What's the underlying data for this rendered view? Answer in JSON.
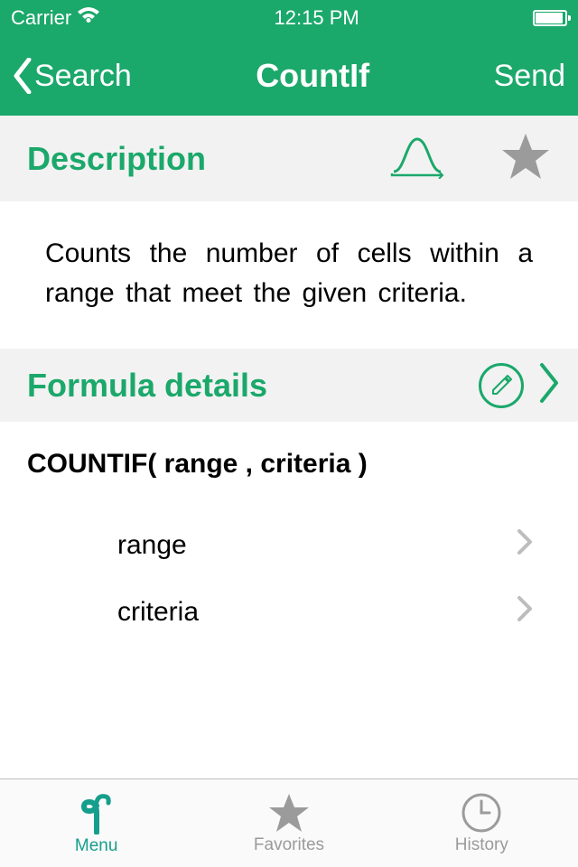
{
  "status": {
    "carrier": "Carrier",
    "time": "12:15 PM"
  },
  "nav": {
    "back_label": "Search",
    "title": "CountIf",
    "send_label": "Send"
  },
  "description": {
    "heading": "Description",
    "text": "Counts the number of cells within a range that meet the given criteria."
  },
  "formula": {
    "heading": "Formula details",
    "signature": "COUNTIF( range , criteria )",
    "params": [
      {
        "label": "range"
      },
      {
        "label": "criteria"
      }
    ]
  },
  "tabs": {
    "menu": "Menu",
    "favorites": "Favorites",
    "history": "History"
  }
}
